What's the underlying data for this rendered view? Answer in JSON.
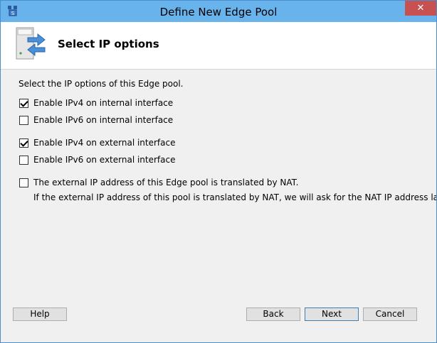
{
  "window": {
    "title": "Define New Edge Pool",
    "close_glyph": "✕"
  },
  "header": {
    "title": "Select IP options",
    "icon": "server-arrows-icon"
  },
  "content": {
    "intro": "Select the IP options of this Edge pool.",
    "options": [
      {
        "label": "Enable IPv4 on internal interface",
        "checked": true
      },
      {
        "label": "Enable IPv6 on internal interface",
        "checked": false
      },
      {
        "label": "Enable IPv4 on external interface",
        "checked": true
      },
      {
        "label": "Enable IPv6 on external interface",
        "checked": false
      },
      {
        "label": "The external IP address of this Edge pool is translated by NAT.",
        "checked": false
      }
    ],
    "nat_note": "If the external IP address of this pool is translated by NAT, we will ask for the NAT IP address later."
  },
  "buttons": {
    "help": "Help",
    "back": "Back",
    "next": "Next",
    "cancel": "Cancel"
  },
  "colors": {
    "title_bar": "#69b3ec",
    "close_button": "#c75050",
    "dialog_bg": "#f0f0f0"
  }
}
